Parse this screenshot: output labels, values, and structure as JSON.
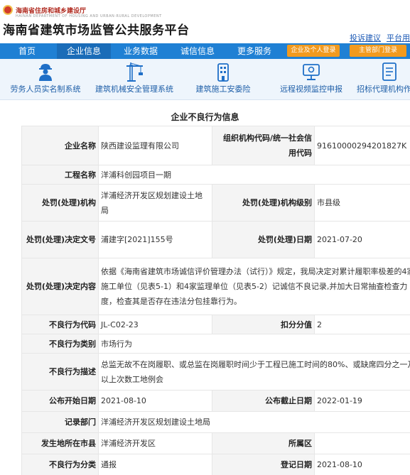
{
  "header": {
    "dept_name": "海南省住房和城乡建设厅",
    "dept_sub": "HAINAN DEPARTMENT OF HOUSING AND URBAN-RURAL DEVELOPMENT",
    "site_title": "海南省建筑市场监管公共服务平台",
    "links": [
      "投诉建议",
      "平台用"
    ]
  },
  "nav": {
    "items": [
      "首页",
      "企业信息",
      "业务数据",
      "诚信信息",
      "更多服务"
    ],
    "buttons": [
      "企业及个人登录",
      "主管部门登录"
    ]
  },
  "quick_menu": [
    {
      "label": "劳务人员实名制系统",
      "icon": "worker-icon"
    },
    {
      "label": "建筑机械安全管理系统",
      "icon": "crane-icon"
    },
    {
      "label": "建筑施工安委险",
      "icon": "building-icon"
    },
    {
      "label": "远程视频监控申报",
      "icon": "monitor-icon"
    },
    {
      "label": "招标代理机构作",
      "icon": "document-icon"
    }
  ],
  "section_title": "企业不良行为信息",
  "record": {
    "company_name_label": "企业名称",
    "company_name": "陕西建设监理有限公司",
    "org_code_label": "组织机构代码/统一社会信用代码",
    "org_code": "91610000294201827K",
    "project_label": "工程名称",
    "project": "洋浦科创园项目一期",
    "authority_label": "处罚(处理)机构",
    "authority": "洋浦经济开发区规划建设土地局",
    "authority_level_label": "处罚(处理)机构级别",
    "authority_level": "市县级",
    "decision_no_label": "处罚(处理)决定文号",
    "decision_no": "浦建字[2021]155号",
    "decision_date_label": "处罚(处理)日期",
    "decision_date": "2021-07-20",
    "decision_content_label": "处罚(处理)决定内容",
    "decision_content": "依据《海南省建筑市场诚信评价管理办法（试行）》规定，我局决定对累计履职率极差的4家施工单位（见表5-1）和4家监理单位（见表5-2）记诚信不良记录,并加大日常抽查检查力度，检查其是否存在违法分包挂靠行为。",
    "behavior_code_label": "不良行为代码",
    "behavior_code": "JL-C02-23",
    "score_label": "扣分分值",
    "score": "2",
    "category_label": "不良行为类别",
    "category": "市场行为",
    "description_label": "不良行为描述",
    "description": "总监无故不在岗履职、或总监在岗履职时间少于工程已施工时间的80%、或缺席四分之一及以上次数工地例会",
    "publish_start_label": "公布开始日期",
    "publish_start": "2021-08-10",
    "publish_end_label": "公布截止日期",
    "publish_end": "2022-01-19",
    "record_dept_label": "记录部门",
    "record_dept": "洋浦经济开发区规划建设土地局",
    "location_city_label": "发生地所在市县",
    "location_city": "洋浦经济开发区",
    "district_label": "所属区",
    "district": "",
    "classification_label": "不良行为分类",
    "classification": "通报",
    "register_date_label": "登记日期",
    "register_date": "2021-08-10"
  },
  "colors": {
    "nav_blue": "#1f80d4",
    "nav_button_orange": "#f29a1e",
    "link_blue": "#1b59b5",
    "quick_bg": "#eef5fc"
  }
}
